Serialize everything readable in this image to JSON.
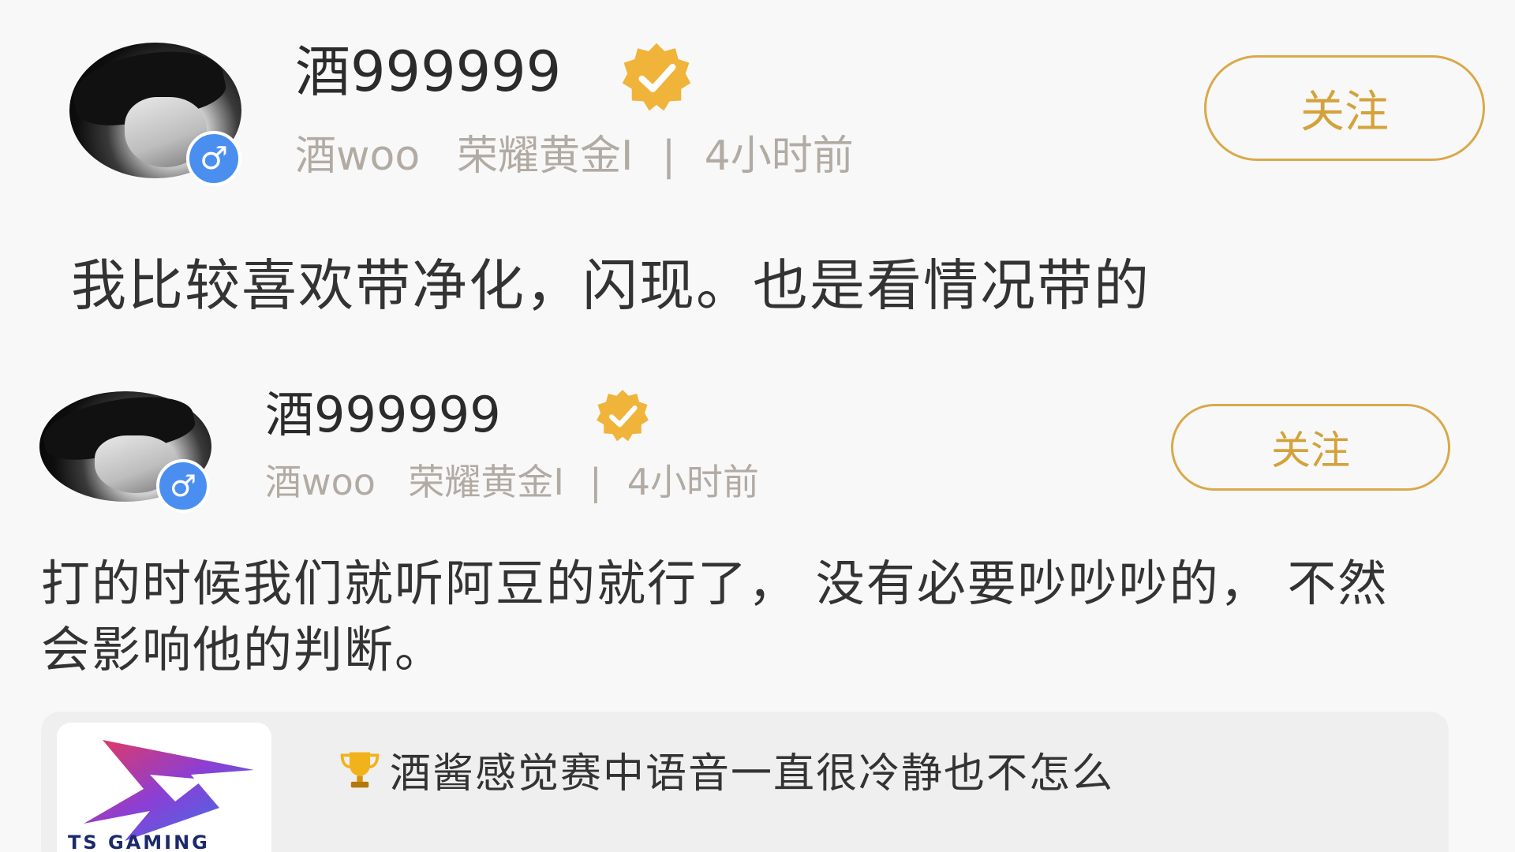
{
  "posts": [
    {
      "username": "酒999999",
      "nickname": "酒woo",
      "rank": "荣耀黄金I",
      "separator": "|",
      "time": "4小时前",
      "follow_label": "关注",
      "text": "我比较喜欢带净化，闪现。也是看情况带的",
      "gender_symbol": "♂"
    },
    {
      "username": "酒999999",
      "nickname": "酒woo",
      "rank": "荣耀黄金I",
      "separator": "|",
      "time": "4小时前",
      "follow_label": "关注",
      "text": "打的时候我们就听阿豆的就行了， 没有必要吵吵吵的， 不然会影响他的判断。",
      "gender_symbol": "♂"
    }
  ],
  "card": {
    "logo_text": "TS GAMING",
    "text": "酒酱感觉赛中语音一直很冷静也不怎么",
    "icon": "trophy-icon"
  },
  "colors": {
    "background": "#f8f8f8",
    "accent_gold": "#d9a94a",
    "meta_gray": "#b2aba3",
    "gender_blue": "#4a8ff0",
    "card_bg": "#efefef"
  }
}
